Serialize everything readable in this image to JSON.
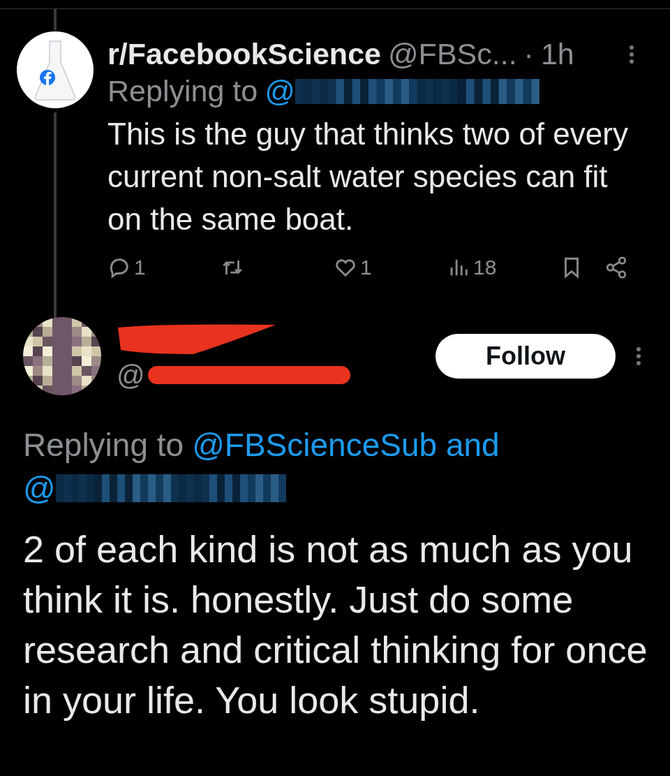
{
  "post": {
    "author": {
      "name": "r/FacebookScience",
      "handle": "@FBSc...",
      "separator": "·",
      "time": "1h"
    },
    "replying_to": {
      "prefix": "Replying to",
      "mentions": [
        "@"
      ]
    },
    "text": "This is the guy that thinks two of every current non-salt water species can fit on the same boat.",
    "actions": [
      {
        "kind": "reply",
        "count": "1"
      },
      {
        "kind": "repost"
      },
      {
        "kind": "like",
        "count": "1"
      },
      {
        "kind": "views",
        "count": "18"
      },
      {
        "kind": "bookmark"
      },
      {
        "kind": "share"
      }
    ]
  },
  "reply": {
    "author": {
      "handle": "@"
    },
    "follow_button": "Follow",
    "replying_to": {
      "prefix": "Replying to",
      "mentions": [
        "@FBScienceSub and",
        "@"
      ]
    },
    "text": "2 of each kind is not as much as you think it is. honestly. Just do some research and critical thinking for once in your life. You look stupid."
  }
}
